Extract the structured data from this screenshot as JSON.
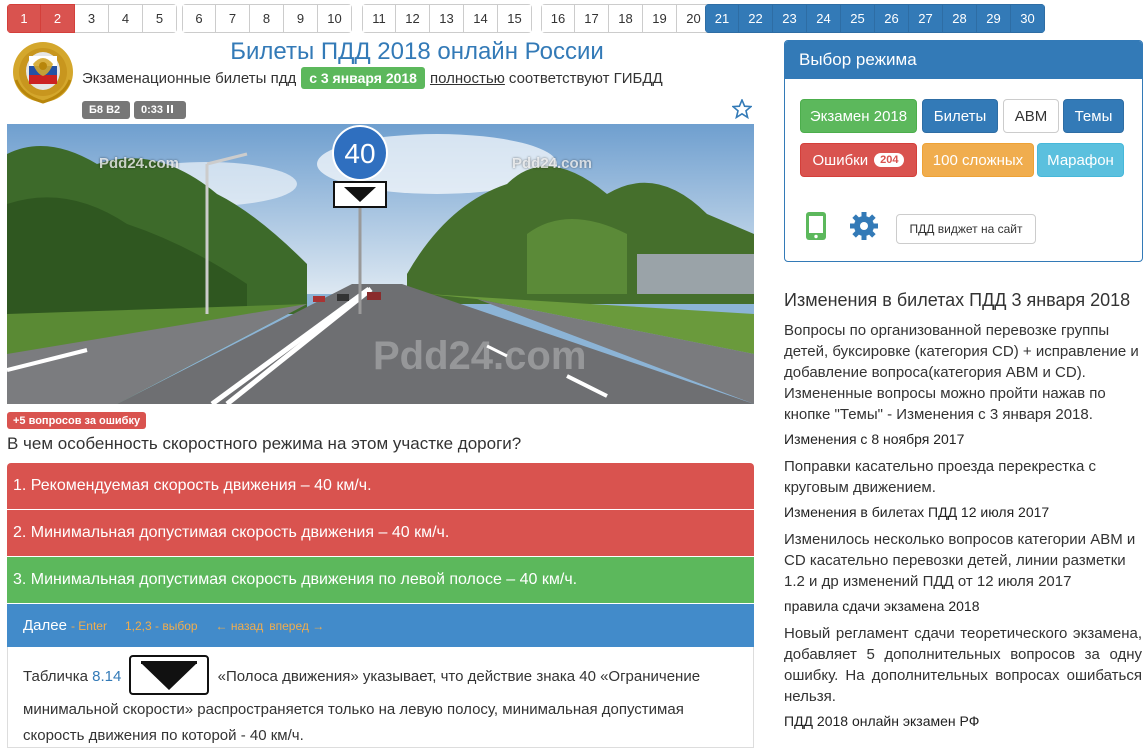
{
  "question_bar": {
    "groups": [
      [
        "1",
        "2",
        "3",
        "4",
        "5"
      ],
      [
        "6",
        "7",
        "8",
        "9",
        "10"
      ],
      [
        "11",
        "12",
        "13",
        "14",
        "15"
      ],
      [
        "16",
        "17",
        "18",
        "19",
        "20"
      ],
      [
        "21",
        "22",
        "23",
        "24",
        "25",
        "26",
        "27",
        "28",
        "29",
        "30"
      ]
    ],
    "answered_wrong": [
      "1",
      "2"
    ],
    "colors": {
      "wrong": "#d9534f",
      "highlighted": "#337ab7",
      "default": "#ffffff"
    }
  },
  "header": {
    "title": "Билеты ПДД 2018 онлайн России",
    "subtitle_before": "Экзаменационные билеты пдд",
    "date_badge": "с 3 января 2018",
    "subtitle_link": "полностью",
    "subtitle_after": "соответствуют ГИБДД",
    "logo_icon": "gibdd-emblem-icon"
  },
  "ticket": {
    "category_badge": "Б8 В2",
    "timer": "0:33",
    "pause_icon": "pause-icon",
    "favorite_icon": "star-icon"
  },
  "photo": {
    "watermark_small": "Pdd24.com",
    "watermark_big": "Pdd24.com",
    "sign_value": "40"
  },
  "question": {
    "bonus_badge": "+5 вопросов за ошибку",
    "text": "В чем особенность скоростного режима на этом участке дороги?",
    "answers": [
      "1. Рекомендуемая скорость движения – 40 км/ч.",
      "2. Минимальная допустимая скорость движения – 40 км/ч.",
      "3. Минимальная допустимая скорость движения по левой полосе – 40 км/ч."
    ],
    "answer_colors": [
      "#d9534f",
      "#d9534f",
      "#5cb85c"
    ],
    "next_label": "Далее",
    "hint_enter": "- Enter",
    "hint_choice": "1,2,3 - выбор",
    "hint_back": "← назад",
    "hint_forward": "вперед →"
  },
  "explanation": {
    "prefix": "Табличка",
    "sign_link": "8.14",
    "text": "«Полоса движения» указывает, что действие знака 40 «Ограничение минимальной скорости» распространяется только на левую полосу, минимальная допустимая скорость движения по которой - 40 км/ч."
  },
  "mode_panel": {
    "heading": "Выбор режима",
    "buttons": {
      "exam": "Экзамен 2018",
      "tickets": "Билеты",
      "abm": "АВМ",
      "themes": "Темы",
      "errors": "Ошибки",
      "errors_count": "204",
      "hard": "100 сложных",
      "marathon": "Марафон",
      "widget": "ПДД виджет на сайт"
    },
    "icons": {
      "phone": "mobile-phone-icon",
      "settings": "gear-icon"
    }
  },
  "news": {
    "title": "Изменения в билетах ПДД 3 января 2018",
    "p1": "Вопросы по организованной перевозке группы детей, буксировке (категория CD) + исправление и добавление вопроса(категория АВМ и CD). Измененные вопросы можно пройти нажав по кнопке \"Темы\" - Изменения с 3 января 2018.",
    "h2": "Изменения с 8 ноября 2017",
    "p2": "Поправки касательно проезда перекрестка с круговым движением.",
    "h3": "Изменения в билетах ПДД 12 июля 2017",
    "p3": "Изменилось несколько вопросов категории АВМ и CD касательно перевозки детей, линии разметки 1.2 и др изменений ПДД от 12 июля 2017",
    "h4": "правила сдачи экзамена 2018",
    "p4": "Новый регламент сдачи теоретического экзамена, добавляет 5 дополнительных вопросов за одну ошибку. На дополнительных вопросах ошибаться нельзя.",
    "h5": "ПДД 2018 онлайн экзамен РФ"
  }
}
